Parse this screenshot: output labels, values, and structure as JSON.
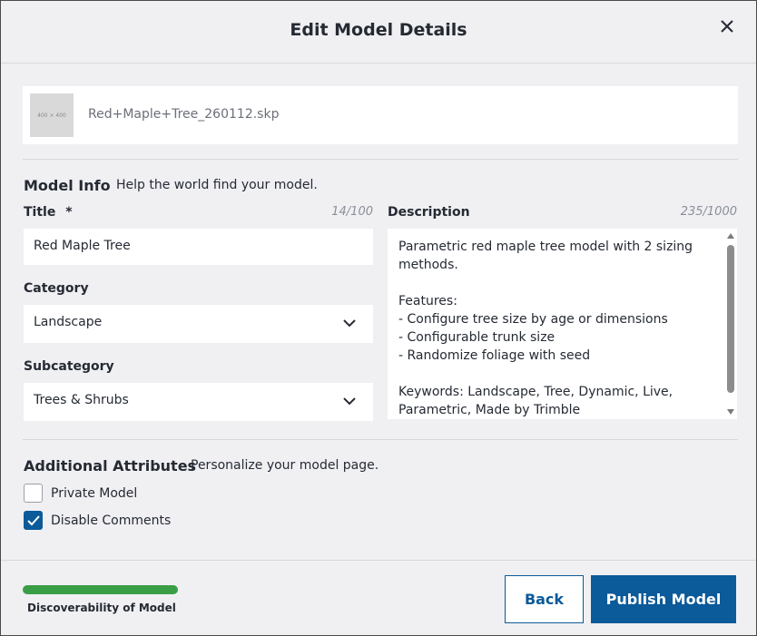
{
  "dialog": {
    "title": "Edit Model Details",
    "close_icon": "close-icon"
  },
  "file": {
    "thumbnail_text": "400 × 400",
    "name": "Red+Maple+Tree_260112.skp"
  },
  "model_info": {
    "heading": "Model Info",
    "hint": "Help the world find your model.",
    "title_label": "Title",
    "title_required_mark": "*",
    "title_counter": "14/100",
    "title_value": "Red Maple Tree",
    "category_label": "Category",
    "category_value": "Landscape",
    "subcategory_label": "Subcategory",
    "subcategory_value": "Trees & Shrubs",
    "description_label": "Description",
    "description_counter": "235/1000",
    "description_value": "Parametric red maple tree model with 2 sizing methods.\n\nFeatures:\n- Configure tree size by age or dimensions\n- Configurable trunk size\n- Randomize foliage with seed\n\nKeywords: Landscape, Tree, Dynamic, Live, Parametric, Made by Trimble"
  },
  "additional_attributes": {
    "heading": "Additional Attributes",
    "hint": "Personalize your model page.",
    "options": [
      {
        "label": "Private Model",
        "checked": false
      },
      {
        "label": "Disable Comments",
        "checked": true
      }
    ]
  },
  "footer": {
    "discoverability_label": "Discoverability of Model",
    "discoverability_progress": 1.0,
    "back_label": "Back",
    "publish_label": "Publish Model"
  },
  "colors": {
    "accent": "#0b5a9a",
    "progress": "#3a9e47",
    "background": "#f0f0f3"
  }
}
